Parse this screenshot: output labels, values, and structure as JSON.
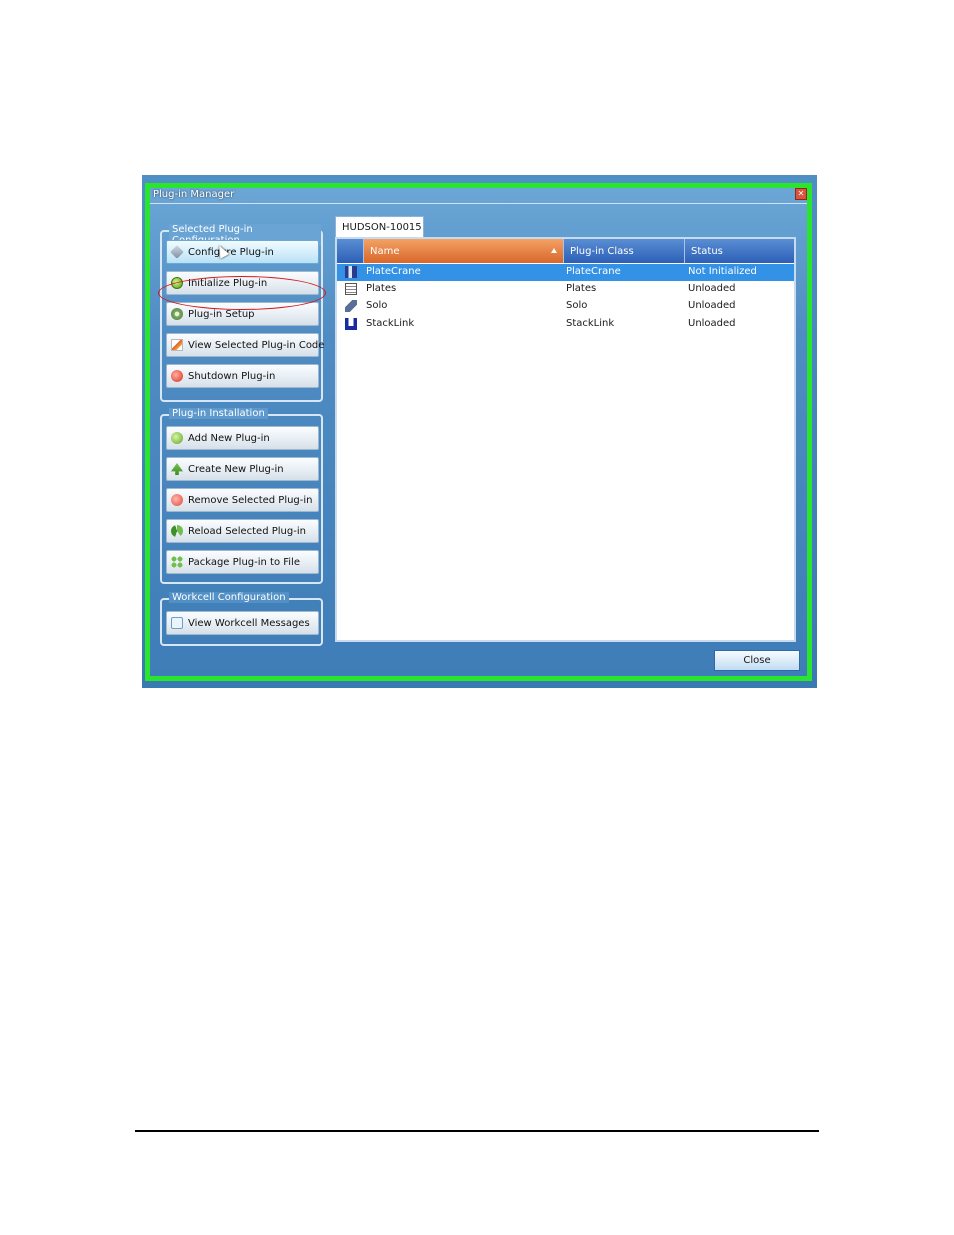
{
  "window": {
    "title": "Plug-in Manager",
    "close_glyph": "✕"
  },
  "groups": {
    "selected_config": {
      "label": "Selected Plug-in Configuration",
      "buttons": [
        {
          "label": "Configure Plug-in",
          "icon": "wand-icon"
        },
        {
          "label": "Initialize Plug-in",
          "icon": "initialize-icon"
        },
        {
          "label": "Plug-in Setup",
          "icon": "gear-icon"
        },
        {
          "label": "View Selected Plug-in Code",
          "icon": "code-icon"
        },
        {
          "label": "Shutdown Plug-in",
          "icon": "shutdown-icon"
        }
      ]
    },
    "installation": {
      "label": "Plug-in Installation",
      "buttons": [
        {
          "label": "Add New Plug-in",
          "icon": "add-icon"
        },
        {
          "label": "Create New Plug-in",
          "icon": "create-icon"
        },
        {
          "label": "Remove Selected Plug-in",
          "icon": "remove-icon"
        },
        {
          "label": "Reload Selected Plug-in",
          "icon": "reload-icon"
        },
        {
          "label": "Package Plug-in to File",
          "icon": "package-icon"
        }
      ]
    },
    "workcell": {
      "label": "Workcell Configuration",
      "buttons": [
        {
          "label": "View Workcell Messages",
          "icon": "messages-icon"
        }
      ]
    }
  },
  "tab": {
    "label": "HUDSON-10015"
  },
  "table": {
    "columns": [
      "Name",
      "Plug-in Class",
      "Status"
    ],
    "sorted_column": "Name",
    "rows": [
      {
        "name": "PlateCrane",
        "class": "PlateCrane",
        "status": "Not Initialized",
        "icon": "platecrane-icon",
        "selected": true
      },
      {
        "name": "Plates",
        "class": "Plates",
        "status": "Unloaded",
        "icon": "plates-icon",
        "selected": false
      },
      {
        "name": "Solo",
        "class": "Solo",
        "status": "Unloaded",
        "icon": "solo-icon",
        "selected": false
      },
      {
        "name": "StackLink",
        "class": "StackLink",
        "status": "Unloaded",
        "icon": "stacklink-icon",
        "selected": false
      }
    ]
  },
  "close_button": {
    "label": "Close"
  },
  "colors": {
    "highlight_border": "#29e52d",
    "annotation_ellipse": "#d21818",
    "selected_row": "#3392e6",
    "sorted_header": "#d8662a"
  }
}
